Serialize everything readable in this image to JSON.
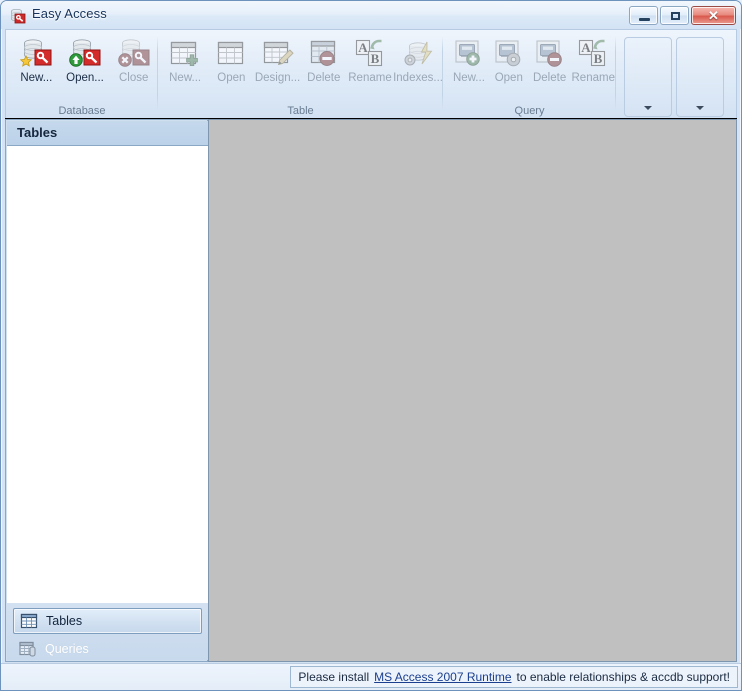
{
  "window": {
    "title": "Easy Access",
    "icon": "access-database-icon",
    "controls": {
      "minimize": "minimize-button",
      "maximize": "maximize-button",
      "close": "✕"
    }
  },
  "ribbon": {
    "groups": [
      {
        "label": "Database",
        "name": "database",
        "buttons": [
          {
            "label": "New...",
            "icon": "database-new-icon",
            "disabled": false
          },
          {
            "label": "Open...",
            "icon": "database-open-icon",
            "disabled": false
          },
          {
            "label": "Close",
            "icon": "database-close-icon",
            "disabled": true
          }
        ]
      },
      {
        "label": "Table",
        "name": "table",
        "buttons": [
          {
            "label": "New...",
            "icon": "table-new-icon",
            "disabled": true
          },
          {
            "label": "Open",
            "icon": "table-open-icon",
            "disabled": true
          },
          {
            "label": "Design...",
            "icon": "table-design-icon",
            "disabled": true
          },
          {
            "label": "Delete",
            "icon": "table-delete-icon",
            "disabled": true
          },
          {
            "label": "Rename",
            "icon": "rename-ab-icon",
            "disabled": true
          },
          {
            "label": "Indexes...",
            "icon": "indexes-icon",
            "disabled": true
          }
        ]
      },
      {
        "label": "Query",
        "name": "query",
        "buttons": [
          {
            "label": "New...",
            "icon": "query-new-icon",
            "disabled": true
          },
          {
            "label": "Open",
            "icon": "query-open-icon",
            "disabled": true
          },
          {
            "label": "Delete",
            "icon": "query-delete-icon",
            "disabled": true
          },
          {
            "label": "Rename",
            "icon": "rename-ab-icon",
            "disabled": true
          }
        ]
      }
    ],
    "side_panels": [
      {
        "name": "ribbon-panel-1",
        "chevron": "chevron-down-icon"
      },
      {
        "name": "ribbon-panel-2",
        "chevron": "chevron-down-icon"
      }
    ]
  },
  "sidebar": {
    "header": "Tables",
    "list_items": [],
    "nav": [
      {
        "label": "Tables",
        "icon": "grid-table-icon",
        "selected": true,
        "disabled": false
      },
      {
        "label": "Queries",
        "icon": "grid-query-icon",
        "selected": false,
        "disabled": true
      }
    ]
  },
  "workspace": {
    "background": "#c0c0c0",
    "content": ""
  },
  "statusbar": {
    "text_before": "Please install",
    "link": "MS Access 2007 Runtime",
    "text_after": "to enable relationships & accdb support!"
  },
  "colors": {
    "frame": "#6d93bd",
    "ribbon_bg": "#e2ecf8",
    "sidebar_bg": "#cfdff0",
    "workspace_bg": "#c0c0c0",
    "title_text": "#17335c",
    "link": "#1b3f8f",
    "close_button": "#d9594d"
  }
}
